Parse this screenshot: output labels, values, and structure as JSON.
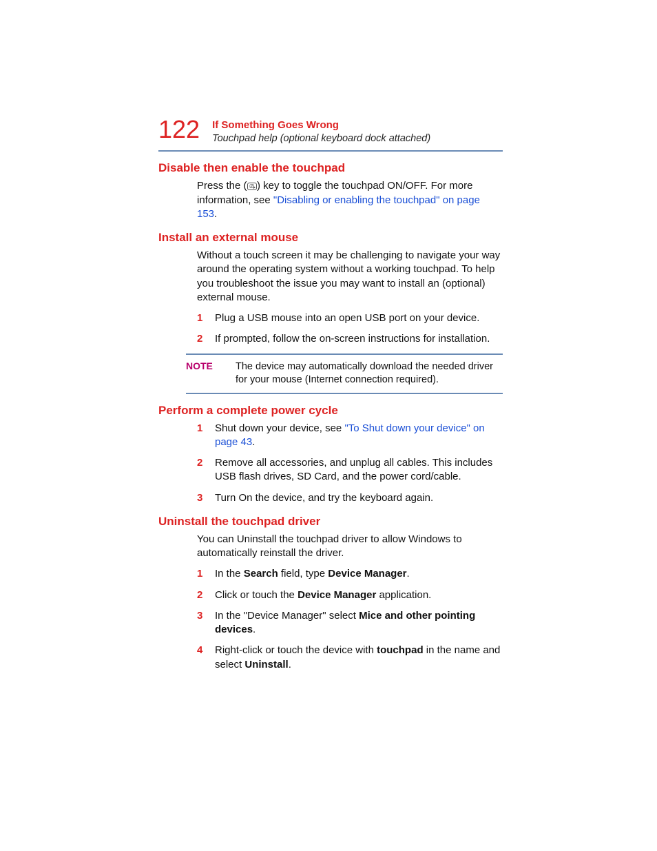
{
  "header": {
    "page_number": "122",
    "chapter": "If Something Goes Wrong",
    "section": "Touchpad help (optional keyboard dock attached)"
  },
  "s1": {
    "heading": "Disable then enable the touchpad",
    "p1a": "Press the (",
    "p1b": ") key to toggle the touchpad ON/OFF. For more information, see ",
    "link": "\"Disabling or enabling the touchpad\" on page 153",
    "p1c": "."
  },
  "s2": {
    "heading": "Install an external mouse",
    "p1": "Without a touch screen it may be challenging to navigate your way around the operating system without a working touchpad. To help you troubleshoot the issue you may want to install an (optional) external mouse.",
    "li1": "Plug a USB mouse into an open USB port on your device.",
    "li2": "If prompted, follow the on-screen instructions for installation."
  },
  "note": {
    "label": "NOTE",
    "text": "The device may automatically download the needed driver for your mouse (Internet connection required)."
  },
  "s3": {
    "heading": "Perform a complete power cycle",
    "li1a": "Shut down your device, see ",
    "li1_link": "\"To Shut down your device\" on page 43",
    "li1b": ".",
    "li2": "Remove all accessories, and unplug all cables. This includes USB flash drives, SD Card, and the power cord/cable.",
    "li3": "Turn On the device, and try the keyboard again."
  },
  "s4": {
    "heading": "Uninstall the touchpad driver",
    "p1": "You can Uninstall the touchpad driver to allow Windows to automatically reinstall the driver.",
    "li1a": "In the ",
    "li1b": "Search",
    "li1c": " field, type ",
    "li1d": "Device Manager",
    "li1e": ".",
    "li2a": "Click or touch the ",
    "li2b": "Device Manager",
    "li2c": " application.",
    "li3a": "In the \"Device Manager\" select ",
    "li3b": "Mice and other pointing devices",
    "li3c": ".",
    "li4a": "Right-click or touch the device with ",
    "li4b": "touchpad",
    "li4c": " in the name and select ",
    "li4d": "Uninstall",
    "li4e": "."
  },
  "nums": {
    "n1": "1",
    "n2": "2",
    "n3": "3",
    "n4": "4"
  }
}
